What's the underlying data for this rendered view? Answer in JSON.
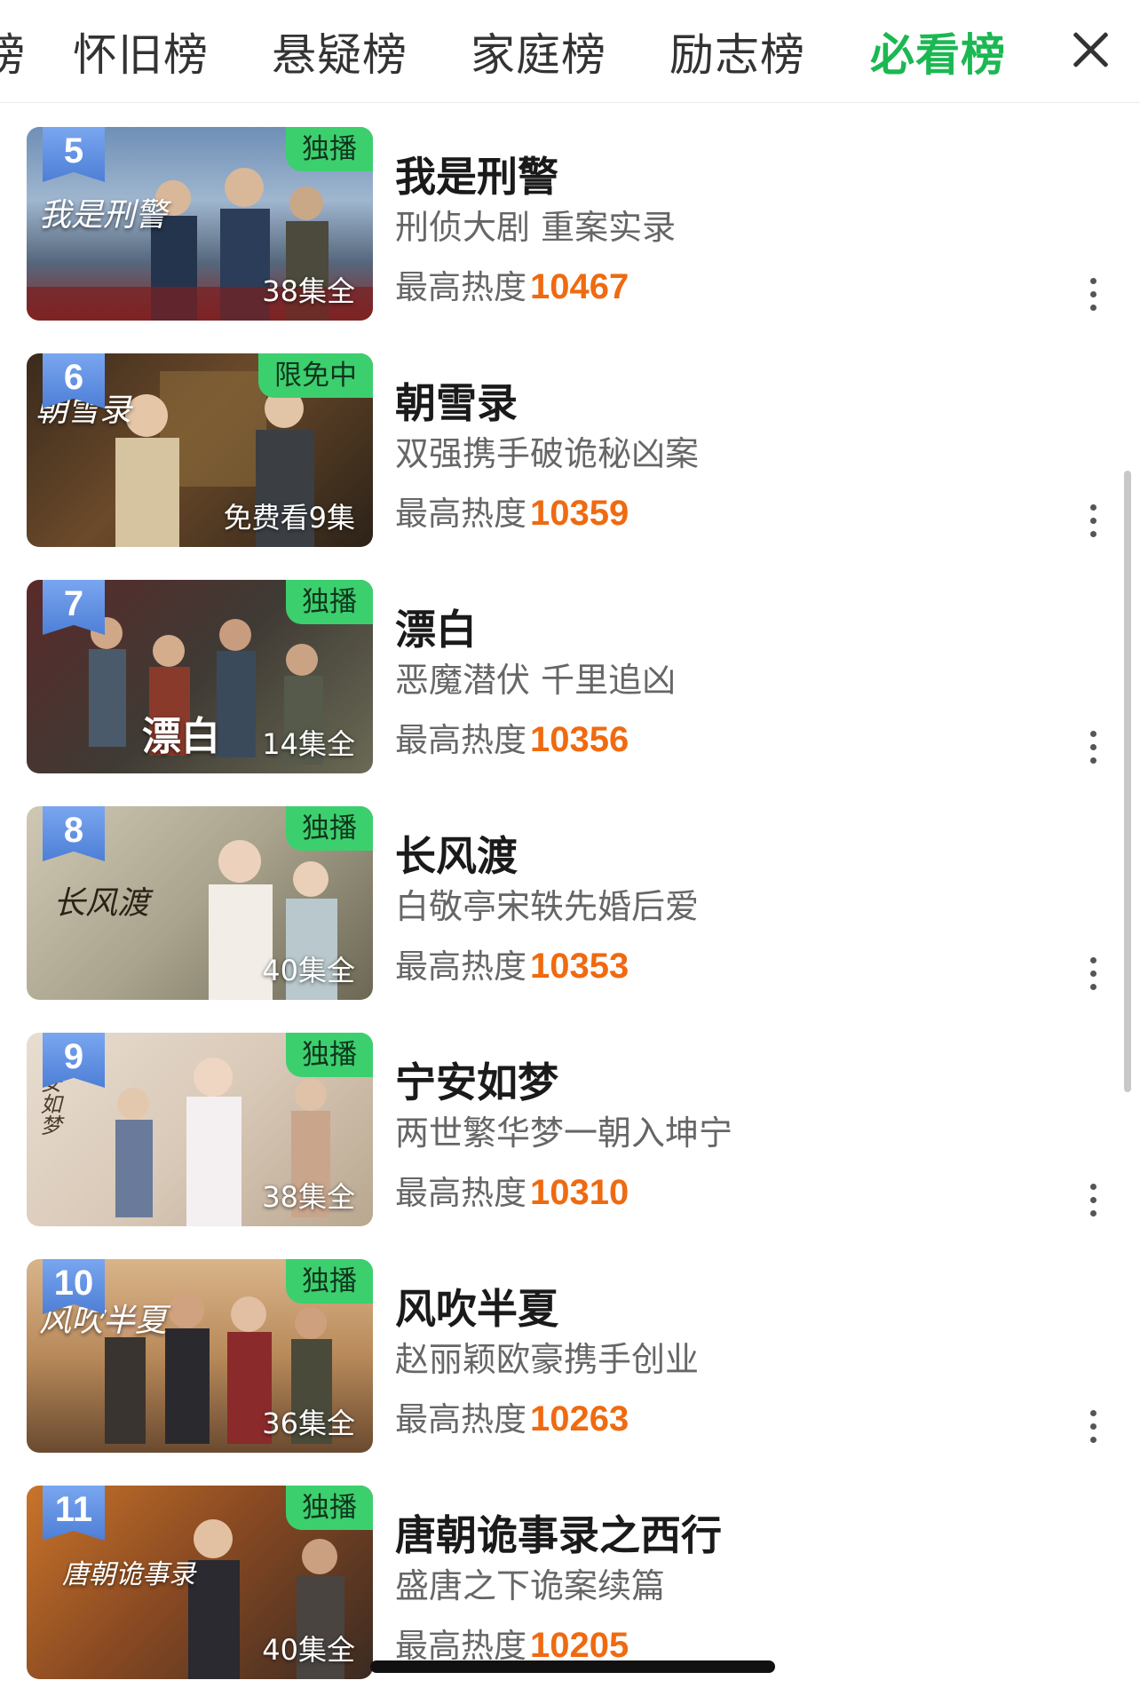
{
  "tabs": {
    "partial": "榜",
    "items": [
      "怀旧榜",
      "悬疑榜",
      "家庭榜",
      "励志榜",
      "必看榜"
    ],
    "active_index": 4
  },
  "heat_label": "最高热度",
  "items": [
    {
      "rank": "5",
      "badge": "独播",
      "episodes": "38集全",
      "title": "我是刑警",
      "desc": "刑侦大剧 重案实录",
      "heat": "10467",
      "logo": "我是刑警"
    },
    {
      "rank": "6",
      "badge": "限免中",
      "episodes": "免费看9集",
      "title": "朝雪录",
      "desc": "双强携手破诡秘凶案",
      "heat": "10359",
      "logo": "朝雪录"
    },
    {
      "rank": "7",
      "badge": "独播",
      "episodes": "14集全",
      "title": "漂白",
      "desc": "恶魔潜伏 千里追凶",
      "heat": "10356",
      "logo": "漂白"
    },
    {
      "rank": "8",
      "badge": "独播",
      "episodes": "40集全",
      "title": "长风渡",
      "desc": "白敬亭宋轶先婚后爱",
      "heat": "10353",
      "logo": "长风渡"
    },
    {
      "rank": "9",
      "badge": "独播",
      "episodes": "38集全",
      "title": "宁安如梦",
      "desc": "两世繁华梦一朝入坤宁",
      "heat": "10310",
      "logo": "宁安如梦"
    },
    {
      "rank": "10",
      "badge": "独播",
      "episodes": "36集全",
      "title": "风吹半夏",
      "desc": "赵丽颖欧豪携手创业",
      "heat": "10263",
      "logo": "风吹半夏"
    },
    {
      "rank": "11",
      "badge": "独播",
      "episodes": "40集全",
      "title": "唐朝诡事录之西行",
      "desc": "盛唐之下诡案续篇",
      "heat": "10205",
      "logo": "唐朝诡事录"
    }
  ],
  "colors": {
    "active_tab": "#1bb852",
    "heat_number": "#ef6a10",
    "badge_bg": "#3ccf6e",
    "rank_bg": "#5b8de0"
  }
}
